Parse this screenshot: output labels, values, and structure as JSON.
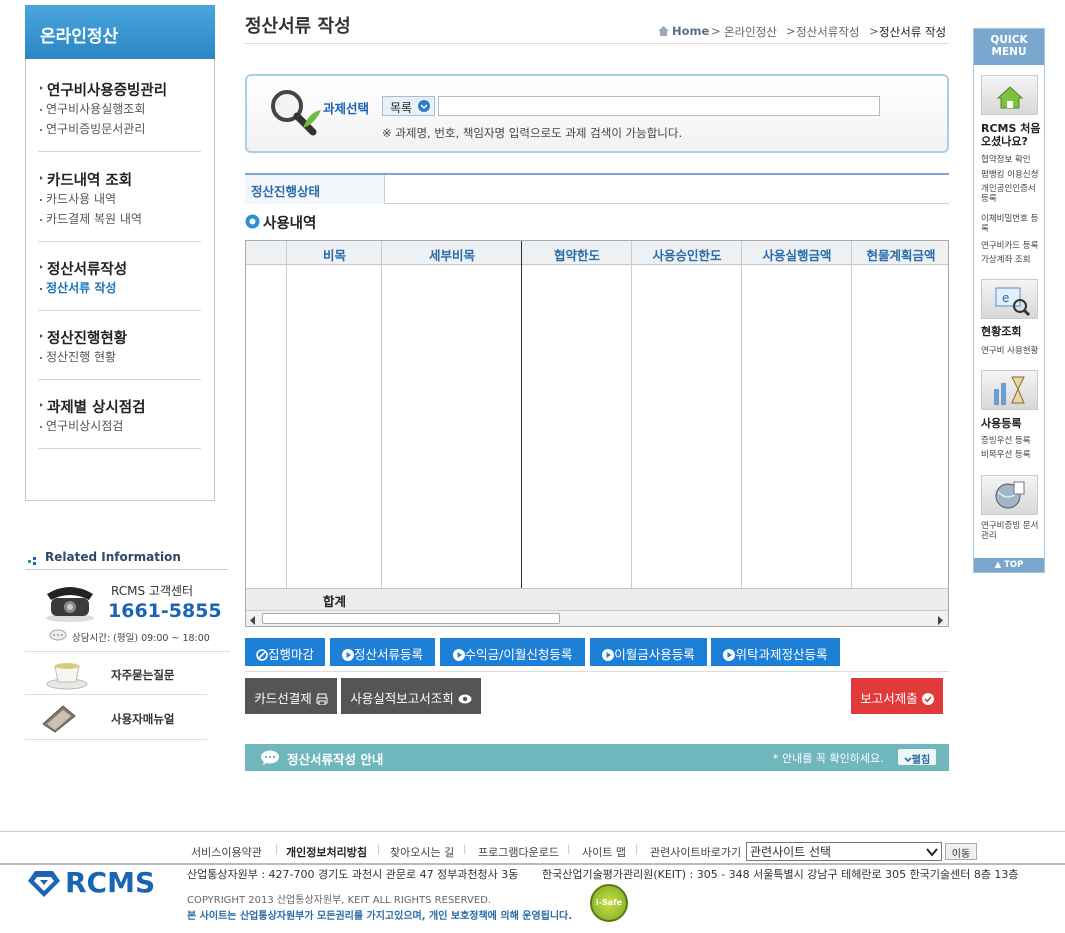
{
  "sidebar": {
    "header": "온라인정산",
    "groups": [
      {
        "title": "연구비사용증빙관리",
        "items": [
          "연구비사용실행조회",
          "연구비증빙문서관리"
        ]
      },
      {
        "title": "카드내역 조회",
        "items": [
          "카드사용 내역",
          "카드결제 복원 내역"
        ]
      },
      {
        "title": "정산서류작성",
        "items": [
          "정산서류 작성"
        ]
      },
      {
        "title": "정산진행현황",
        "items": [
          "정산진행 현황"
        ]
      },
      {
        "title": "과제별 상시점검",
        "items": [
          "연구비상시점검"
        ]
      }
    ],
    "related": {
      "title": "Related Information",
      "center_label": "RCMS 고객센터",
      "phone": "1661-5855",
      "hours": "상담시간: (평일) 09:00 ~ 18:00",
      "faq": "자주묻는질문",
      "manual": "사용자매뉴얼"
    }
  },
  "header": {
    "title": "정산서류 작성",
    "breadcrumb": [
      "Home",
      "온라인정산",
      "정산서류작성",
      "정산서류 작성"
    ]
  },
  "search": {
    "label": "과제선택",
    "select_value": "목록",
    "input_value": "",
    "hint": "※ 과제명, 번호, 책임자명 입력으로도 과제 검색이 가능합니다."
  },
  "status": {
    "label": "정산진행상태",
    "value": ""
  },
  "usage": {
    "title": "사용내역",
    "columns": [
      "",
      "비목",
      "세부비목",
      "협약한도",
      "사용승인한도",
      "사용실행금액",
      "현물계획금액"
    ],
    "total_label": "합계"
  },
  "actions": {
    "blue": [
      "집행마감",
      "정산서류등록",
      "수익금/이월신청등록",
      "이월금사용등록",
      "위탁과제정산등록"
    ],
    "card_payment": "카드선결제",
    "report_view": "사용실적보고서조회",
    "submit": "보고서제출"
  },
  "guide": {
    "title": "정산서류작성 안내",
    "note": "* 안내를 꼭 확인하세요.",
    "expand": "펼침"
  },
  "quick_menu": {
    "header": [
      "QUICK",
      "MENU"
    ],
    "sections": [
      {
        "title": "RCMS 처음 오셨나요?",
        "links": [
          "협약정보 확인",
          "펌뱅킹 이용신청",
          "개인공인인증서 등록",
          "이체비밀번호 등록",
          "연구비카드 등록",
          "가상계좌 조회"
        ]
      },
      {
        "title": "현황조회",
        "links": [
          "연구비 사용현황"
        ]
      },
      {
        "title": "사용등록",
        "links": [
          "증빙우선 등록",
          "비목우선 등록"
        ]
      },
      {
        "title": "",
        "links": [
          "연구비증빙 문서 관리"
        ]
      }
    ],
    "top": "TOP"
  },
  "footer": {
    "links": [
      "서비스이용약관",
      "개인정보처리방침",
      "찾아오시는 길",
      "프로그램다운로드",
      "사이트 맵",
      "관련사이트바로가기"
    ],
    "site_select": "관련사이트 선택",
    "go": "이동",
    "logo": "RCMS",
    "address1": "산업통상자원부 : 427-700 경기도 과천시 관문로 47 정부과천청사 3동",
    "address2": "한국산업기술평가관리원(KEIT) : 305 - 348  서울특별시 강남구 테헤란로 305 한국기술센터 8층 13층",
    "copyright": "COPYRIGHT 2013 산업통상자원부, KEIT ALL RIGHTS RESERVED.",
    "rights": "본 사이트는 산업통상자원부가 모든권리를 가지고있으며, 개인 보호정책에 의해 운영됩니다.",
    "badge": "i-Safe"
  },
  "colors": {
    "accent": "#1d7fd6",
    "submit": "#e03a3a",
    "guide": "#70b6bd"
  }
}
